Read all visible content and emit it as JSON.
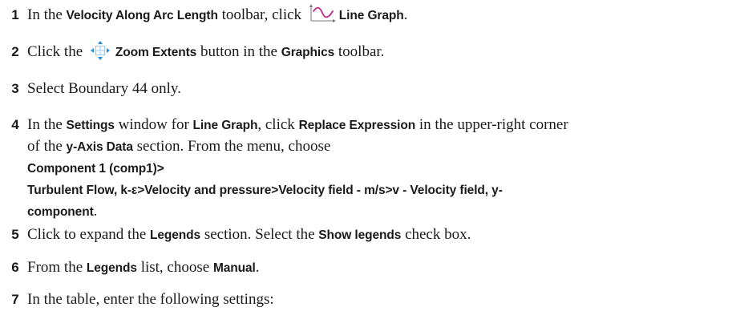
{
  "steps": [
    {
      "num": "1",
      "t1": "In the ",
      "b1": "Velocity Along Arc Length",
      "t2": " toolbar, click ",
      "icon": "line-graph-icon",
      "b2": "Line Graph",
      "t3": "."
    },
    {
      "num": "2",
      "t1": "Click the ",
      "icon": "zoom-extents-icon",
      "b1": "Zoom Extents",
      "t2": " button in the ",
      "b2": "Graphics",
      "t3": " toolbar."
    },
    {
      "num": "3",
      "t1": "Select Boundary 44 only."
    },
    {
      "num": "4",
      "t1": "In the ",
      "b1": "Settings",
      "t2": " window for ",
      "b2": "Line Graph",
      "t3": ", click ",
      "b3": "Replace Expression",
      "t4": " in the upper-right corner",
      "t5": "of the ",
      "b4": "y-Axis Data",
      "t6": " section. From the menu, choose ",
      "b5": "Component 1 (comp1)>",
      "b6": "Turbulent Flow, k-ε>Velocity and pressure>Velocity field - m/s>v - Velocity field, y-",
      "b7": "component",
      "t7": "."
    },
    {
      "num": "5",
      "t1": "Click to expand the ",
      "b1": "Legends",
      "t2": " section. Select the ",
      "b2": "Show legends",
      "t3": " check box."
    },
    {
      "num": "6",
      "t1": "From the ",
      "b1": "Legends",
      "t2": " list, choose ",
      "b2": "Manual",
      "t3": "."
    },
    {
      "num": "7",
      "t1": "In the table, enter the following settings:"
    }
  ],
  "colors": {
    "text": "#1a1a1a",
    "line_graph_curve": "#c02a8a",
    "line_graph_axis": "#7a7a7a",
    "zoom_arrows": "#1f8fe0",
    "zoom_box": "#9ac8ee"
  }
}
